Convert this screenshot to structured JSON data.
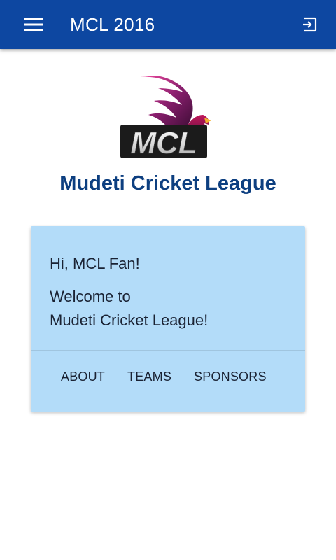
{
  "app_bar": {
    "title": "MCL 2016",
    "menu_icon": "hamburger-menu-icon",
    "exit_icon": "logout-icon",
    "background_color": "#0d47a1"
  },
  "logo": {
    "text": "MCL"
  },
  "league_name": "Mudeti Cricket League",
  "card": {
    "greeting": "Hi, MCL Fan!",
    "welcome_line1": "Welcome to",
    "welcome_line2": "Mudeti Cricket League!",
    "background_color": "#b3dcf9",
    "actions": [
      "ABOUT",
      "TEAMS",
      "SPONSORS"
    ]
  }
}
